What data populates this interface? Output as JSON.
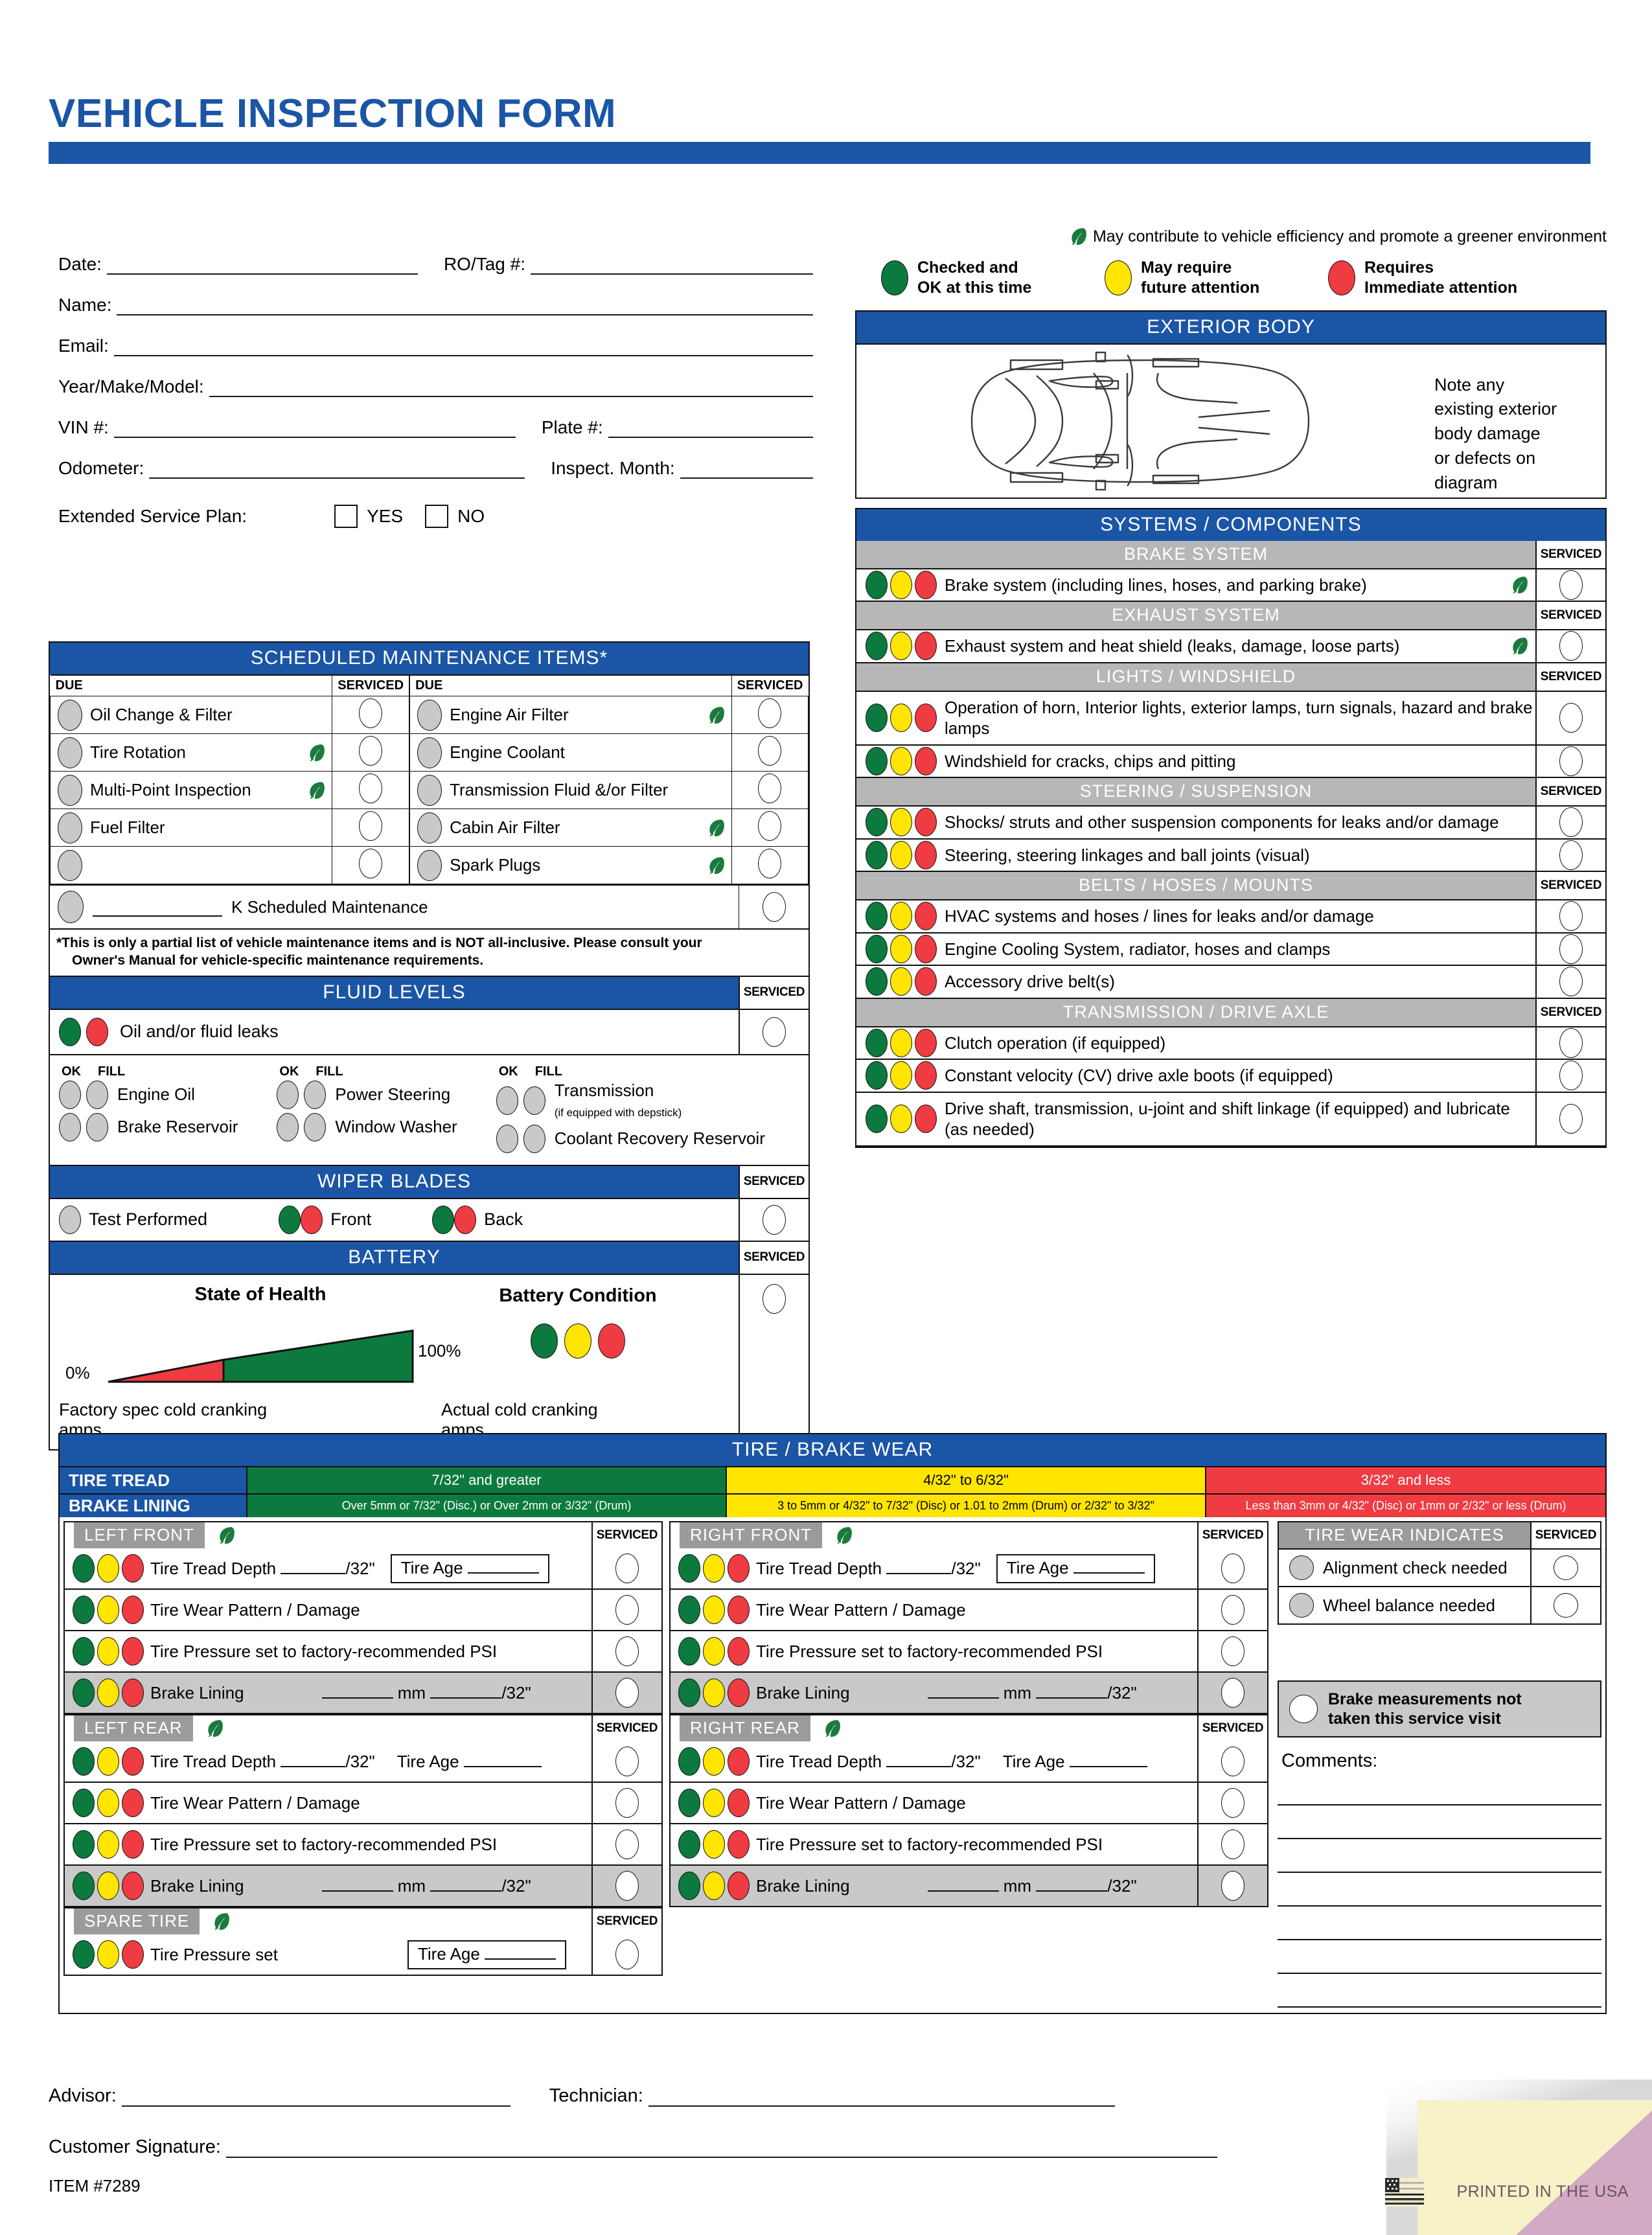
{
  "header": {
    "title": "VEHICLE INSPECTION FORM"
  },
  "customer": {
    "date_label": "Date:",
    "rotag_label": "RO/Tag #:",
    "name_label": "Name:",
    "email_label": "Email:",
    "ymm_label": "Year/Make/Model:",
    "vin_label": "VIN #:",
    "plate_label": "Plate #:",
    "odometer_label": "Odometer:",
    "inspect_month_label": "Inspect. Month:",
    "esp_label": "Extended Service Plan:",
    "yes_label": "YES",
    "no_label": "NO"
  },
  "legend": {
    "eco_note": "May contribute to vehicle efficiency and promote a greener environment",
    "items": [
      {
        "color": "#0c7a3e",
        "line1": "Checked and",
        "line2": "OK at this time"
      },
      {
        "color": "#ffe500",
        "line1": "May require",
        "line2": "future attention"
      },
      {
        "color": "#ef3b42",
        "line1": "Requires",
        "line2": "Immediate attention"
      }
    ]
  },
  "exterior_body": {
    "title": "EXTERIOR BODY",
    "note": [
      "Note any",
      "existing exterior",
      "body damage",
      "or defects on",
      "diagram"
    ]
  },
  "scheduled_maintenance": {
    "title": "SCHEDULED MAINTENANCE ITEMS*",
    "due_header": "DUE",
    "serviced_header": "SERVICED",
    "left_items": [
      {
        "label": "Oil Change & Filter",
        "leaf": false
      },
      {
        "label": "Tire Rotation",
        "leaf": true
      },
      {
        "label": "Multi-Point Inspection",
        "leaf": true
      },
      {
        "label": "Fuel Filter",
        "leaf": false
      },
      {
        "label": "",
        "leaf": false
      }
    ],
    "right_items": [
      {
        "label": "Engine Air Filter",
        "leaf": true
      },
      {
        "label": "Engine Coolant",
        "leaf": false
      },
      {
        "label": "Transmission Fluid &/or Filter",
        "leaf": false
      },
      {
        "label": "Cabin Air Filter",
        "leaf": true
      },
      {
        "label": "Spark Plugs",
        "leaf": true
      }
    ],
    "k_scheduled_label": "K Scheduled Maintenance",
    "footnote_line1": "*This is only a partial list of vehicle maintenance items and is NOT all-inclusive. Please consult your",
    "footnote_line2": "Owner's Manual for vehicle-specific maintenance requirements."
  },
  "fluid_levels": {
    "title": "FLUID LEVELS",
    "serviced_header": "SERVICED",
    "leaks_label": "Oil and/or fluid leaks",
    "ok_label": "OK",
    "fill_label": "FILL",
    "columns": [
      [
        {
          "label": "Engine Oil",
          "sub": ""
        },
        {
          "label": "Brake Reservoir",
          "sub": ""
        }
      ],
      [
        {
          "label": "Power Steering",
          "sub": ""
        },
        {
          "label": "Window Washer",
          "sub": ""
        }
      ],
      [
        {
          "label": "Transmission",
          "sub": "(if equipped with depstick)"
        },
        {
          "label": "Coolant Recovery Reservoir",
          "sub": ""
        }
      ]
    ]
  },
  "wiper_blades": {
    "title": "WIPER BLADES",
    "serviced_header": "SERVICED",
    "test_label": "Test Performed",
    "front_label": "Front",
    "back_label": "Back"
  },
  "battery": {
    "title": "BATTERY",
    "serviced_header": "SERVICED",
    "soh_title": "State of Health",
    "soh_min": "0%",
    "soh_max": "100%",
    "condition_title": "Battery Condition",
    "factory_label": "Factory spec cold cranking amps",
    "actual_label": "Actual cold cranking amps"
  },
  "systems": {
    "title": "SYSTEMS / COMPONENTS",
    "serviced_header": "SERVICED",
    "groups": [
      {
        "name": "BRAKE SYSTEM",
        "rows": [
          {
            "text": "Brake system (including lines, hoses, and parking brake)",
            "leaf": true
          }
        ]
      },
      {
        "name": "EXHAUST SYSTEM",
        "rows": [
          {
            "text": "Exhaust system and heat shield (leaks, damage, loose parts)",
            "leaf": true
          }
        ]
      },
      {
        "name": "LIGHTS / WINDSHIELD",
        "rows": [
          {
            "text": "Operation of horn, Interior lights, exterior lamps, turn signals, hazard and brake lamps",
            "leaf": false
          },
          {
            "text": "Windshield for cracks, chips and pitting",
            "leaf": false
          }
        ]
      },
      {
        "name": "STEERING / SUSPENSION",
        "rows": [
          {
            "text": "Shocks/ struts and other suspension components for leaks and/or damage",
            "leaf": false
          },
          {
            "text": "Steering, steering linkages and ball joints (visual)",
            "leaf": false
          }
        ]
      },
      {
        "name": "BELTS / HOSES / MOUNTS",
        "rows": [
          {
            "text": "HVAC systems and hoses / lines for leaks and/or damage",
            "leaf": false
          },
          {
            "text": "Engine Cooling System, radiator, hoses and clamps",
            "leaf": false
          },
          {
            "text": "Accessory drive belt(s)",
            "leaf": false
          }
        ]
      },
      {
        "name": "TRANSMISSION / DRIVE AXLE",
        "rows": [
          {
            "text": "Clutch operation (if equipped)",
            "leaf": false
          },
          {
            "text": "Constant velocity (CV) drive axle boots (if equipped)",
            "leaf": false
          },
          {
            "text": "Drive shaft, transmission, u-joint and shift linkage (if equipped) and lubricate (as needed)",
            "leaf": false
          }
        ]
      }
    ]
  },
  "tire_brake_wear": {
    "title": "TIRE / BRAKE WEAR",
    "tire_tread_label": "TIRE TREAD",
    "brake_lining_label": "BRAKE LINING",
    "tire_tread_bands": [
      "7/32\" and greater",
      "4/32\" to 6/32\"",
      "3/32\" and less"
    ],
    "brake_lining_bands": [
      "Over 5mm or 7/32\" (Disc.) or Over 2mm or 3/32\" (Drum)",
      "3 to 5mm or 4/32\" to 7/32\" (Disc) or 1.01 to 2mm (Drum) or 2/32\" to 3/32\"",
      "Less than 3mm or 4/32\" (Disc) or 1mm or 2/32\" or less (Drum)"
    ],
    "serviced_header": "SERVICED",
    "corners": [
      {
        "name": "LEFT FRONT",
        "leaf": true,
        "tire_age_boxed": true
      },
      {
        "name": "RIGHT FRONT",
        "leaf": true,
        "tire_age_boxed": true
      },
      {
        "name": "LEFT REAR",
        "leaf": true,
        "tire_age_boxed": false
      },
      {
        "name": "RIGHT REAR",
        "leaf": true,
        "tire_age_boxed": false
      }
    ],
    "corner_rows": {
      "tread_depth": "Tire Tread Depth",
      "tread_units": "/32\"",
      "tire_age": "Tire Age",
      "wear_pattern": "Tire Wear Pattern / Damage",
      "pressure": "Tire Pressure set to factory-recommended PSI",
      "brake_lining": "Brake Lining",
      "mm": "mm",
      "thirtyseconds": "/32\""
    },
    "spare": {
      "name": "SPARE TIRE",
      "leaf": true,
      "serviced_header": "SERVICED",
      "pressure_label": "Tire Pressure set",
      "tire_age": "Tire Age"
    },
    "tire_wear_indicates": {
      "title": "TIRE WEAR INDICATES",
      "serviced_header": "SERVICED",
      "items": [
        "Alignment check needed",
        "Wheel balance needed"
      ],
      "brake_note_line1": "Brake measurements not",
      "brake_note_line2": "taken this service visit"
    },
    "comments_label": "Comments:"
  },
  "footer": {
    "advisor_label": "Advisor:",
    "technician_label": "Technician:",
    "signature_label": "Customer Signature:",
    "item_number": "ITEM #7289",
    "printed": "PRINTED IN THE USA"
  },
  "colors": {
    "blue": "#1b55a6",
    "green": "#0c7a3e",
    "yellow": "#ffe500",
    "red": "#ef3b42",
    "gray": "#b7b7b7"
  }
}
